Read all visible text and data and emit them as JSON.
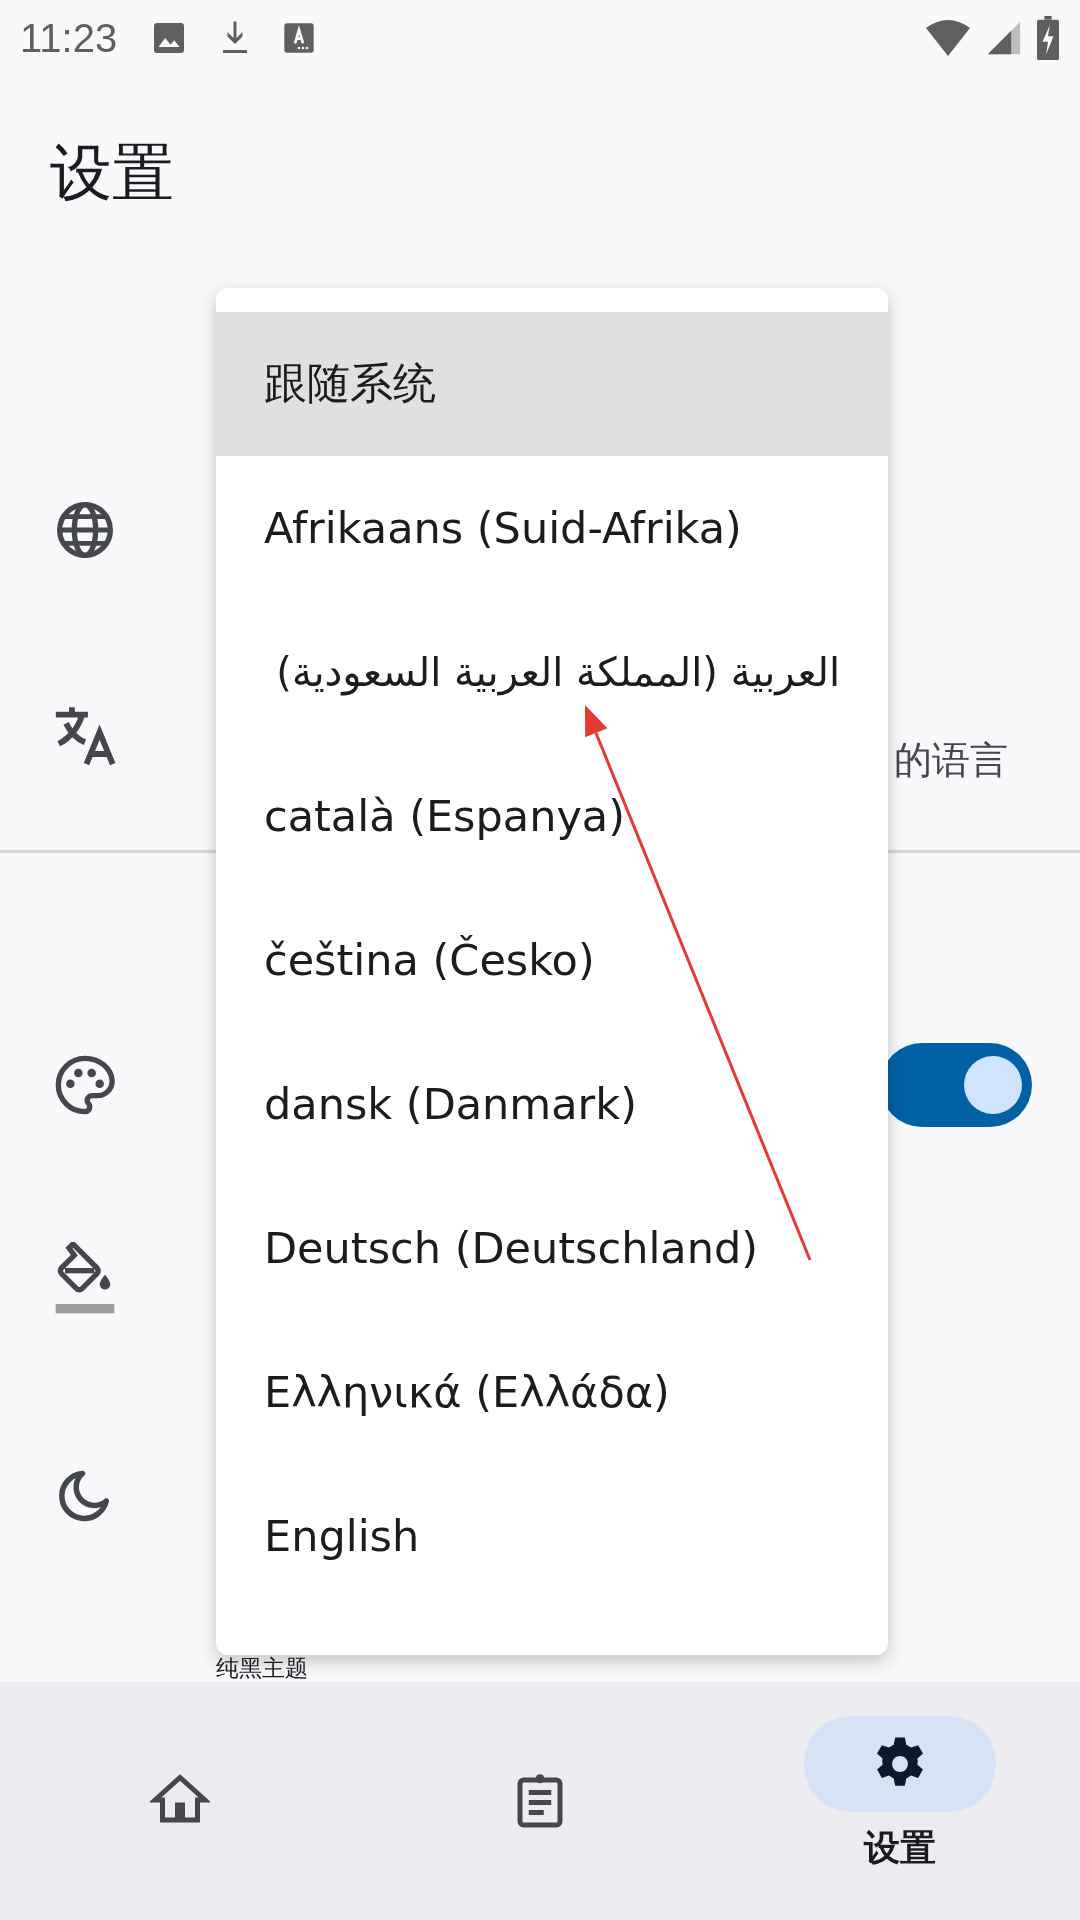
{
  "status_bar": {
    "time": "11:23",
    "notification_icons": [
      {
        "kind": "image"
      },
      {
        "kind": "download"
      },
      {
        "kind": "font"
      }
    ]
  },
  "title": "设置",
  "settings_rows": [
    {
      "kind": "globe"
    },
    {
      "kind": "translate",
      "subtitle": "的语言"
    },
    {
      "kind": "palette",
      "toggle": {
        "on": true
      }
    },
    {
      "kind": "paint"
    },
    {
      "kind": "moon"
    }
  ],
  "partial_row_title": "纯黑主题",
  "language_menu": {
    "items": [
      {
        "label": "跟随系统",
        "selected": true
      },
      {
        "label": "Afrikaans (Suid-Afrika)",
        "selected": false
      },
      {
        "label": "العربية (المملكة العربية السعودية)",
        "selected": false
      },
      {
        "label": "català (Espanya)",
        "selected": false
      },
      {
        "label": "čeština (Česko)",
        "selected": false
      },
      {
        "label": "dansk (Danmark)",
        "selected": false
      },
      {
        "label": "Deutsch (Deutschland)",
        "selected": false
      },
      {
        "label": "Ελληνικά (Ελλάδα)",
        "selected": false
      },
      {
        "label": "English",
        "selected": false
      }
    ]
  },
  "bottom_nav": [
    {
      "kind": "home",
      "selected": false
    },
    {
      "kind": "clipboard",
      "selected": false
    },
    {
      "kind": "settings",
      "label": "设置",
      "selected": true
    }
  ]
}
